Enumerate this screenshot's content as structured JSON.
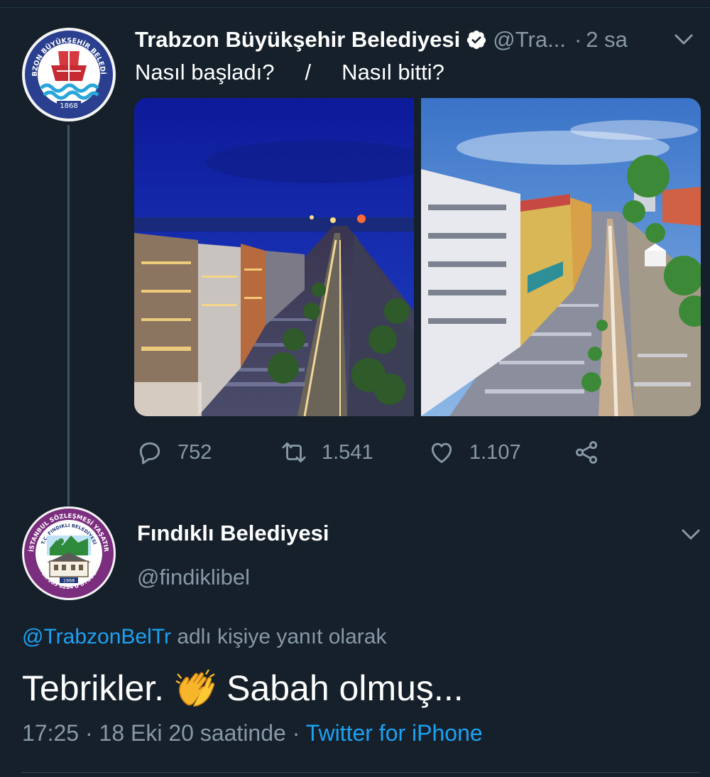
{
  "tweet": {
    "author_name": "Trabzon Büyükşehir Belediyesi",
    "author_handle": "@Tra...",
    "separator": "·",
    "time_ago": "2 sa",
    "text": "Nasıl başladı?     /     Nasıl bitti?",
    "logo_text": "TRABZON BÜYÜKŞEHİR BELEDİYESİ",
    "logo_year": "1868",
    "actions": {
      "replies": "752",
      "retweets": "1.541",
      "likes": "1.107"
    }
  },
  "reply": {
    "author_name": "Fındıklı Belediyesi",
    "author_handle": "@findiklibel",
    "logo_text": "İSTANBUL SÖZLEŞMESİ YAŞATIR",
    "logo_subtext": "T.C. FINDIKLI BELEDİYESİ",
    "logo_year": "1968",
    "logo_bottom": "TCK-103  6284'Ü UYGULA",
    "replying_to": "@TrabzonBelTr",
    "replying_suffix": "adlı kişiye yanıt olarak",
    "text_before": "Tebrikler.",
    "text_after": "Sabah olmuş...",
    "time": "17:25",
    "separator": "·",
    "date": "18 Eki 20 saatinde",
    "separator2": "·",
    "source": "Twitter for iPhone"
  },
  "icons": {
    "reply": "reply-icon",
    "retweet": "retweet-icon",
    "like": "heart-icon",
    "share": "share-icon",
    "verified": "verified-badge-icon",
    "menu": "chevron-down-icon",
    "emoji": "clapping-hands-emoji"
  },
  "colors": {
    "background": "#15202b",
    "secondary_text": "#8899a6",
    "link": "#1da1f2"
  }
}
